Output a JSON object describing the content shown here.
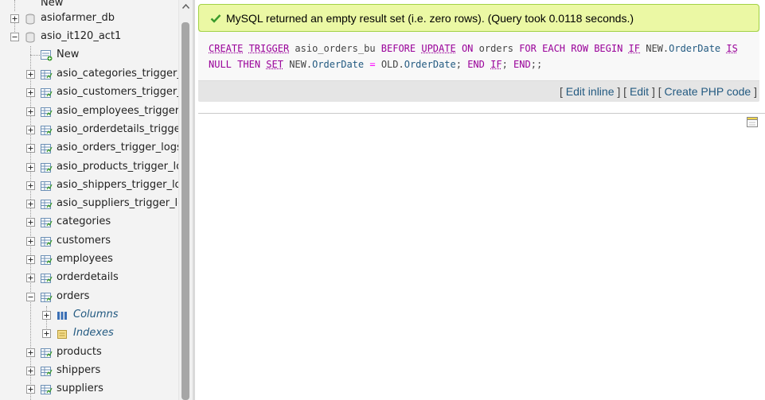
{
  "nav": {
    "top_new_label": "New",
    "databases": [
      {
        "name": "asiofarmer_db"
      },
      {
        "name": "asio_it120_act1"
      }
    ],
    "db_new_label": "New",
    "tables": [
      "asio_categories_trigger_logs",
      "asio_customers_trigger_logs",
      "asio_employees_trigger_logs",
      "asio_orderdetails_trigger_logs",
      "asio_orders_trigger_logs",
      "asio_products_trigger_logs",
      "asio_shippers_trigger_logs",
      "asio_suppliers_trigger_logs",
      "categories",
      "customers",
      "employees",
      "orderdetails",
      "orders"
    ],
    "orders_children": [
      "Columns",
      "Indexes"
    ],
    "tables_after": [
      "products",
      "shippers",
      "suppliers"
    ]
  },
  "main": {
    "success_message": "MySQL returned an empty result set (i.e. zero rows). (Query took 0.0118 seconds.)",
    "sql": {
      "line1": [
        {
          "t": "CREATE",
          "c": "kw"
        },
        {
          "t": " ",
          "c": ""
        },
        {
          "t": "TRIGGER",
          "c": "kw"
        },
        {
          "t": " asio_orders_bu ",
          "c": ""
        },
        {
          "t": "BEFORE",
          "c": "kwp"
        },
        {
          "t": " ",
          "c": ""
        },
        {
          "t": "UPDATE",
          "c": "kw"
        },
        {
          "t": " ",
          "c": ""
        },
        {
          "t": "ON",
          "c": "kwp"
        },
        {
          "t": " orders ",
          "c": ""
        },
        {
          "t": "FOR",
          "c": "kwp"
        },
        {
          "t": " ",
          "c": ""
        },
        {
          "t": "EACH",
          "c": "kwp"
        },
        {
          "t": " ",
          "c": ""
        },
        {
          "t": "ROW",
          "c": "kwp"
        },
        {
          "t": " ",
          "c": ""
        },
        {
          "t": "BEGIN",
          "c": "kwp"
        },
        {
          "t": " ",
          "c": ""
        },
        {
          "t": "IF",
          "c": "kw"
        },
        {
          "t": " NEW.",
          "c": ""
        },
        {
          "t": "OrderDate",
          "c": "col"
        },
        {
          "t": " ",
          "c": ""
        },
        {
          "t": "IS",
          "c": "kw"
        }
      ],
      "line2": [
        {
          "t": "NULL",
          "c": "kwp"
        },
        {
          "t": " ",
          "c": ""
        },
        {
          "t": "THEN",
          "c": "kwp"
        },
        {
          "t": " ",
          "c": ""
        },
        {
          "t": "SET",
          "c": "kw"
        },
        {
          "t": " NEW.",
          "c": ""
        },
        {
          "t": "OrderDate",
          "c": "col"
        },
        {
          "t": " ",
          "c": ""
        },
        {
          "t": "=",
          "c": "op"
        },
        {
          "t": " OLD.",
          "c": ""
        },
        {
          "t": "OrderDate",
          "c": "col"
        },
        {
          "t": "; ",
          "c": ""
        },
        {
          "t": "END",
          "c": "kwp"
        },
        {
          "t": " ",
          "c": ""
        },
        {
          "t": "IF",
          "c": "kw"
        },
        {
          "t": "; ",
          "c": ""
        },
        {
          "t": "END",
          "c": "kwp"
        },
        {
          "t": ";;",
          "c": ""
        }
      ]
    },
    "links": {
      "edit_inline": "Edit inline",
      "edit": "Edit",
      "create_php": "Create PHP code"
    }
  },
  "colors": {
    "success_bg": "#ebf8a4",
    "success_border": "#a2d246",
    "link": "#235a81",
    "keyword": "#990099"
  },
  "icons": [
    "expand-icon",
    "collapse-icon",
    "database-icon",
    "new-icon",
    "table-icon",
    "columns-icon",
    "indexes-icon",
    "check-icon",
    "notepad-icon",
    "scroll-up-icon"
  ]
}
